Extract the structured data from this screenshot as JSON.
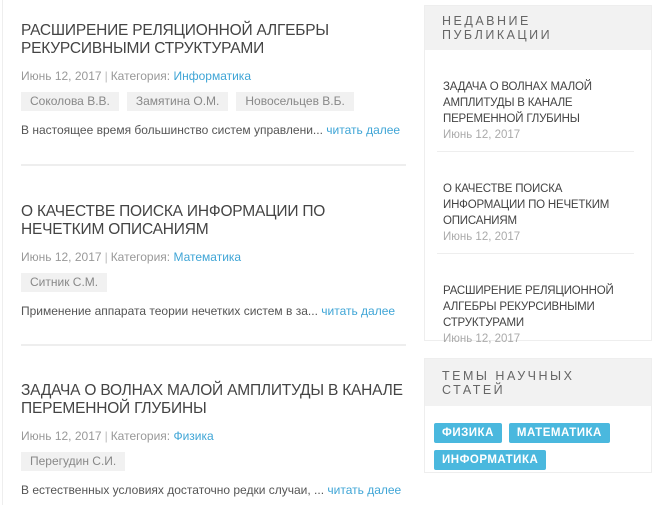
{
  "posts": [
    {
      "title": "Расширение реляционной алгебры рекурсивными структурами",
      "date": "Июнь 12, 2017",
      "category_label": "Категория:",
      "category": "Информатика",
      "authors": [
        "Соколова В.В.",
        "Замятина О.М.",
        "Новосельцев В.Б."
      ],
      "excerpt": "В настоящее время большинство систем управлени...",
      "read_more": "читать далее"
    },
    {
      "title": "О качестве поиска информации по нечетким описаниям",
      "date": "Июнь 12, 2017",
      "category_label": "Категория:",
      "category": "Математика",
      "authors": [
        "Ситник С.М."
      ],
      "excerpt": "Применение аппарата теории нечетких систем в за...",
      "read_more": "читать далее"
    },
    {
      "title": "Задача о волнах малой амплитуды в канале переменной глубины",
      "date": "Июнь 12, 2017",
      "category_label": "Категория:",
      "category": "Физика",
      "authors": [
        "Перегудин С.И."
      ],
      "excerpt": "В естественных условиях достаточно редки случаи, ...",
      "read_more": "читать далее"
    }
  ],
  "sidebar": {
    "recent_title": "Недавние публикации",
    "recent": [
      {
        "title": "Задача о волнах малой амплитуды в канале переменной глубины",
        "date": "Июнь 12, 2017"
      },
      {
        "title": "О качестве поиска информации по нечетким описаниям",
        "date": "Июнь 12, 2017"
      },
      {
        "title": "Расширение реляционной алгебры рекурсивными структурами",
        "date": "Июнь 12, 2017"
      }
    ],
    "topics_title": "Темы научных статей",
    "topics": [
      "ФИЗИКА",
      "МАТЕМАТИКА",
      "ИНФОРМАТИКА"
    ]
  },
  "colors": {
    "accent": "#3fa5d6",
    "tag": "#4ab8de"
  }
}
